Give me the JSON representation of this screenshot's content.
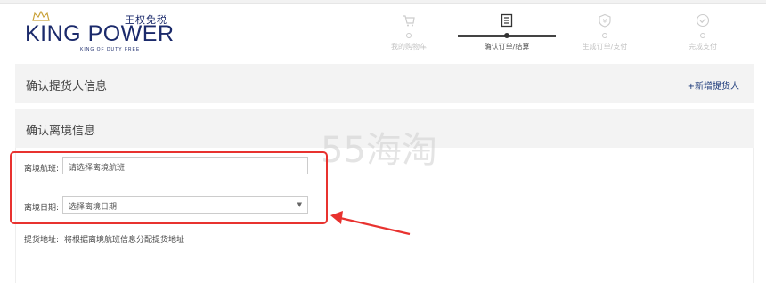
{
  "logo": {
    "cn_text": "王权免税",
    "brand": "KING POWER",
    "subtitle": "KING OF DUTY FREE"
  },
  "steps": [
    {
      "label": "我的购物车",
      "icon": "cart-icon",
      "state": "done"
    },
    {
      "label": "确认订单/结算",
      "icon": "receipt-icon",
      "state": "active"
    },
    {
      "label": "生成订单/支付",
      "icon": "yen-icon",
      "state": "pending"
    },
    {
      "label": "完成支付",
      "icon": "check-circle-icon",
      "state": "pending"
    }
  ],
  "pickup_section": {
    "title": "确认提货人信息",
    "add_link": "+新增提货人"
  },
  "departure_section": {
    "title": "确认离境信息",
    "flight_label": "离境航班:",
    "flight_placeholder": "请选择离境航班",
    "date_label": "离境日期:",
    "date_selected": "选择离境日期",
    "pickup_address_label": "提货地址:",
    "pickup_address_value": "将根据离境航班信息分配提货地址"
  },
  "watermark": "55海淘",
  "colors": {
    "brand_navy": "#1b2a6b",
    "highlight_red": "#e8322f",
    "link_blue": "#1c3a7a"
  }
}
